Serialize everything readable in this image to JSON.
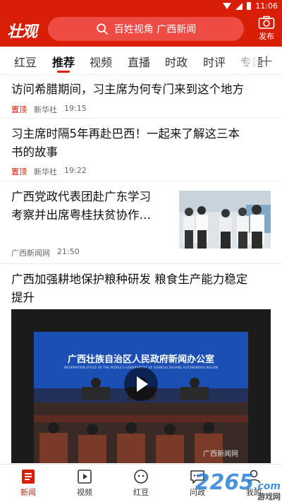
{
  "status_bar": {
    "time": "11:06"
  },
  "header": {
    "logo": "壮观",
    "search_placeholder": "百姓视角 广西新闻",
    "publish_label": "发布"
  },
  "tabs": [
    {
      "label": "红豆"
    },
    {
      "label": "推荐"
    },
    {
      "label": "视频"
    },
    {
      "label": "直播"
    },
    {
      "label": "时政"
    },
    {
      "label": "时评"
    },
    {
      "label": "专题"
    }
  ],
  "feed": [
    {
      "title": "访问希腊期间，习主席为何专门来到这个地方",
      "pin": "置顶",
      "source": "新华社",
      "time": "19:15"
    },
    {
      "title_line1": "习主席时隔5年再赴巴西！一起来了解这三本",
      "title_line2": "书的故事",
      "pin": "置顶",
      "source": "新华社",
      "time": "19:22"
    },
    {
      "title_line1": "广西党政代表团赴广东学习",
      "title_line2": "考察并出席粤桂扶贫协作…",
      "source": "广西新闻网",
      "time": "21:50"
    },
    {
      "title_line1": "广西加强耕地保护粮种研发 粮食生产能力稳定",
      "title_line2": "提升",
      "video_banner": "广西壮族自治区人民政府新闻办公室",
      "video_banner_en": "INFORMATION OFFICE OF THE PEOPLE'S GOVERNMENT OF GUANGXI ZHUANG AUTONOMOUS REGION",
      "video_watermark": "广西新闻网"
    }
  ],
  "bottom_nav": [
    {
      "label": "新闻",
      "icon": "news-icon"
    },
    {
      "label": "视频",
      "icon": "video-icon"
    },
    {
      "label": "红豆",
      "icon": "bean-icon"
    },
    {
      "label": "问政",
      "icon": "chat-icon"
    },
    {
      "label": "我的",
      "icon": "user-icon"
    }
  ],
  "watermark": {
    "brand": "2265",
    "suffix": ".com",
    "site": "游戏网"
  },
  "colors": {
    "accent": "#d81e06"
  }
}
